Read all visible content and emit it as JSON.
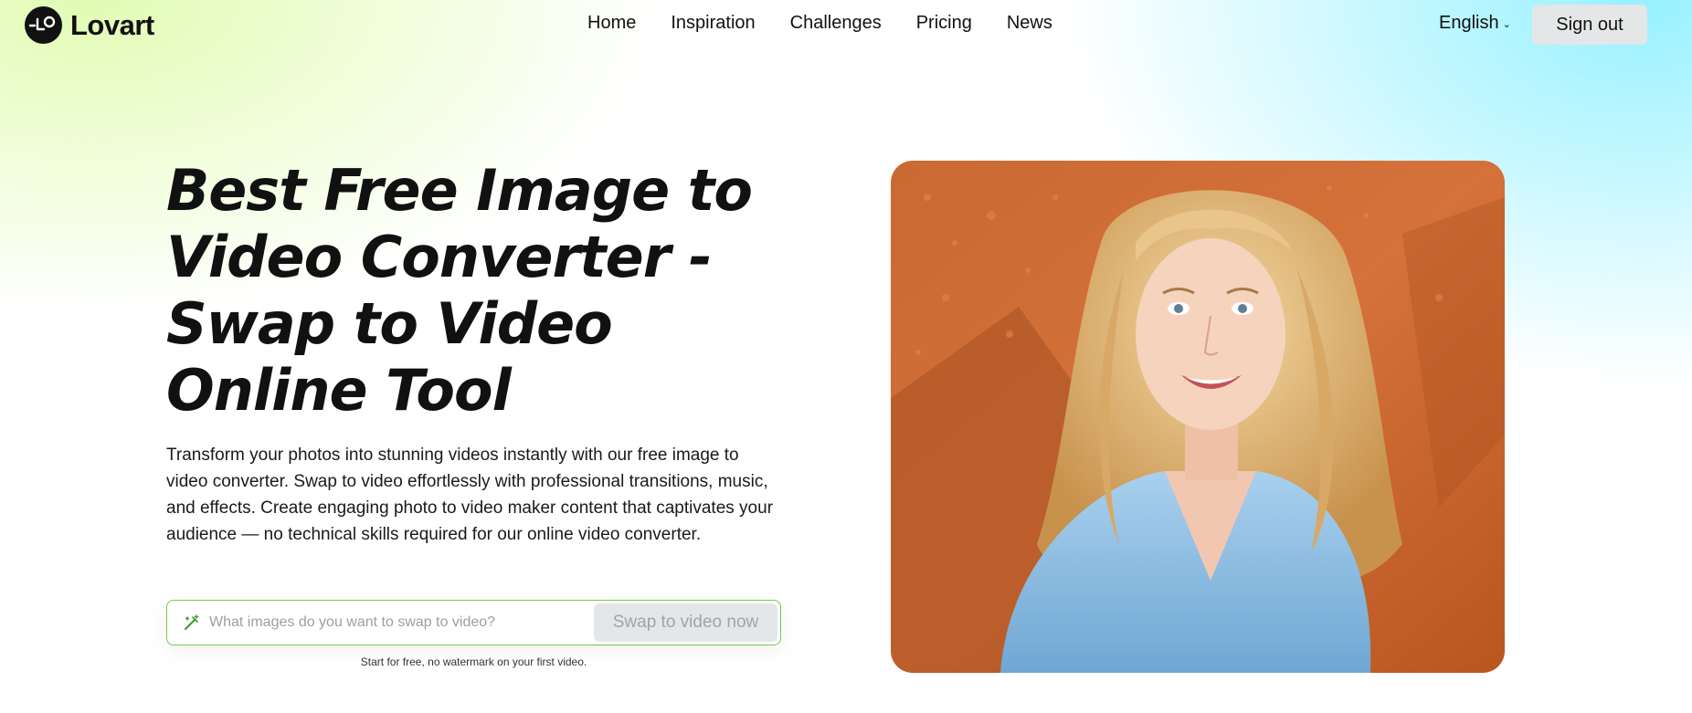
{
  "brand": {
    "name": "Lovart"
  },
  "nav": {
    "items": [
      "Home",
      "Inspiration",
      "Challenges",
      "Pricing",
      "News"
    ],
    "language": "English",
    "sign_out": "Sign out"
  },
  "hero": {
    "title_lines": [
      "Best Free Image to",
      "Video Converter -",
      "Swap to Video",
      "Online Tool"
    ],
    "description": "Transform your photos into stunning videos instantly with our free image to video converter. Swap to video effortlessly with professional transitions, music, and effects. Create engaging photo to video maker content that captivates your audience — no technical skills required for our online video converter.",
    "search": {
      "placeholder": "What images do you want to swap to video?",
      "value": "",
      "button": "Swap to video now"
    },
    "note": "Start for free, no watermark on your first video."
  },
  "icons": {
    "logo": "lovart-logo-icon",
    "language_chevron": "chevron-down-icon",
    "search_prefix": "magic-wand-icon"
  },
  "colors": {
    "accent_green": "#6fcf4a",
    "button_gray": "#e4e6e8",
    "text": "#111111"
  },
  "image": {
    "description_alt": "Smiling woman with long wavy blonde hair in a light blue blouse against a textured orange wall"
  }
}
